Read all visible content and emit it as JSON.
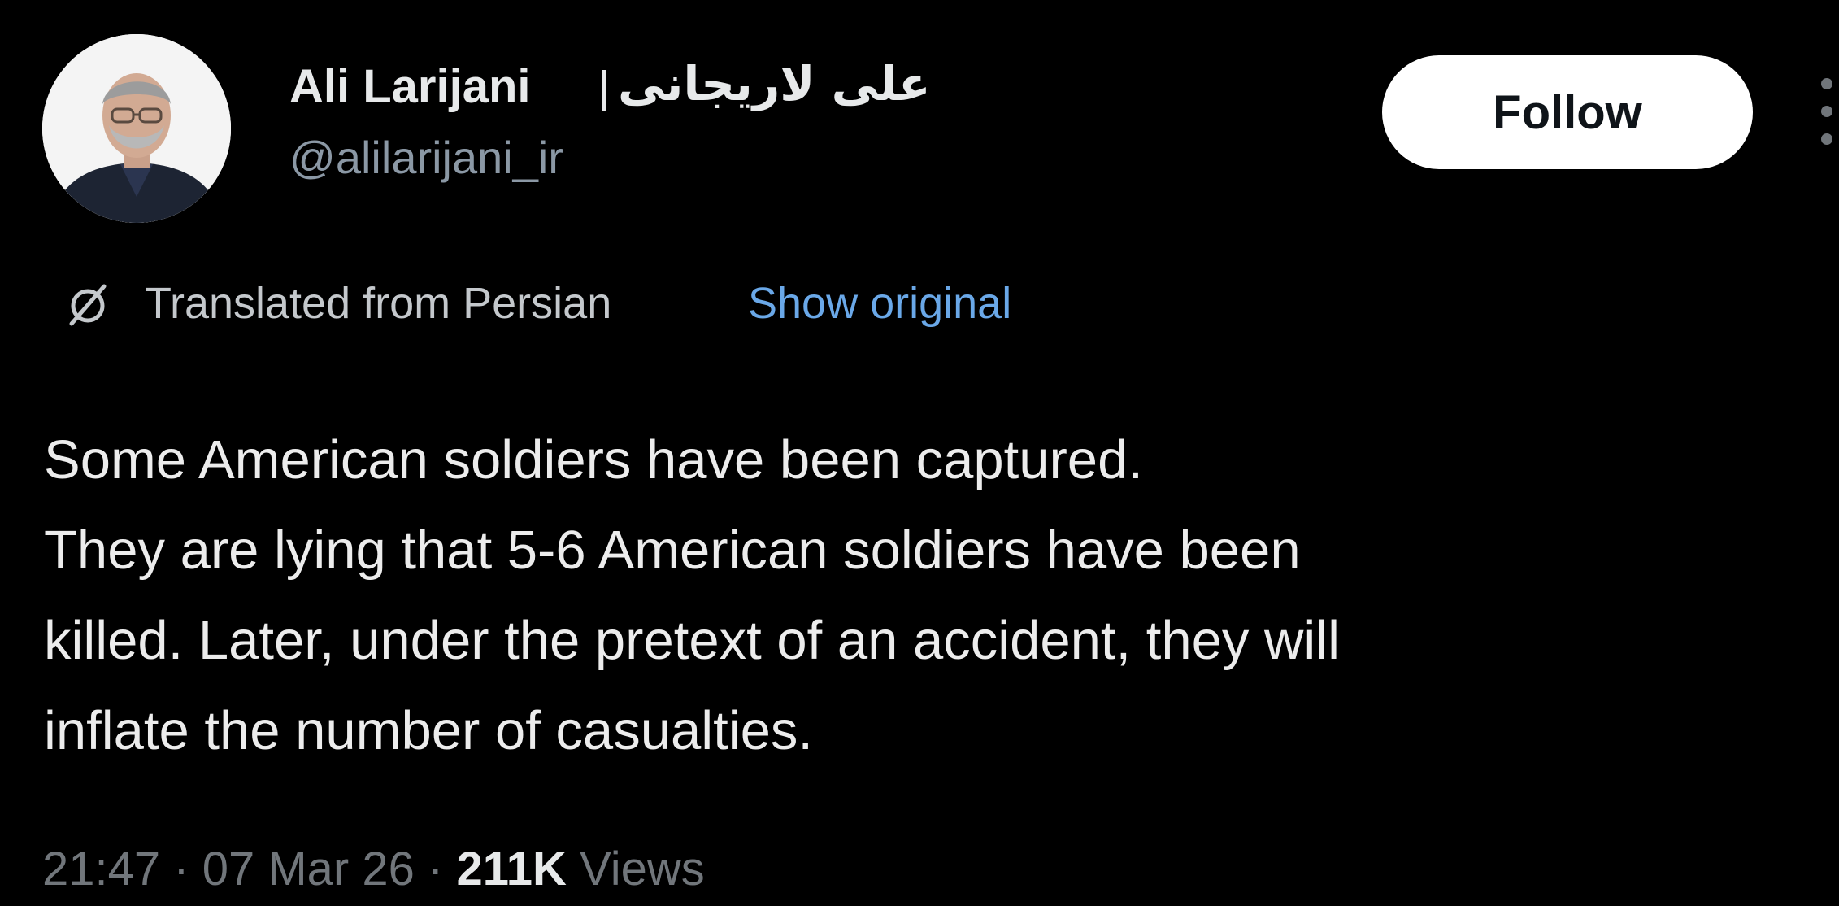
{
  "author": {
    "display_name": "Ali Larijani",
    "separator": "|",
    "persian_name": "علی لاریجانی",
    "handle": "@alilarijani_ir"
  },
  "actions": {
    "follow_label": "Follow",
    "more_icon": "more-vertical-icon"
  },
  "translation": {
    "icon": "translate-globe-icon",
    "label": "Translated from Persian",
    "show_original_label": "Show original"
  },
  "tweet": {
    "lines": [
      "Some American soldiers have been captured.",
      "They are lying that 5-6 American soldiers have been",
      "killed. Later, under the pretext of an accident, they will",
      "inflate the number of casualties."
    ]
  },
  "meta": {
    "time": "21:47",
    "dot": "·",
    "date": "07 Mar 26",
    "views_count": "211K",
    "views_label": "Views"
  },
  "colors": {
    "background": "#000000",
    "text_primary": "#e7e9ea",
    "text_secondary": "#71767b",
    "link": "#6aa8e8",
    "follow_bg": "#ffffff"
  }
}
